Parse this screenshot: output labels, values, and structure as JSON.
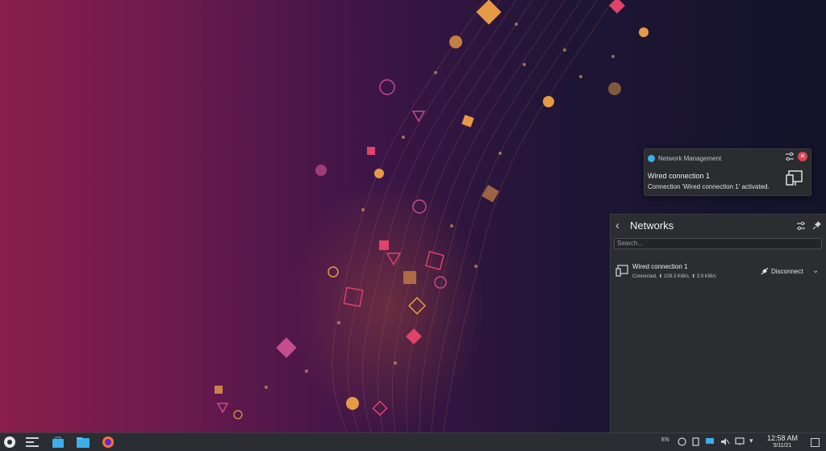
{
  "notification": {
    "app": "Network Management",
    "title": "Wired connection 1",
    "body": "Connection 'Wired connection 1' activated."
  },
  "networks": {
    "title": "Networks",
    "search_placeholder": "Search...",
    "connection": {
      "name": "Wired connection 1",
      "status": "Connected, ⬇ 109.3 KiB/s, ⬆ 3.9 KiB/s",
      "action": "Disconnect"
    }
  },
  "taskbar": {
    "keyboard_layout": "EN",
    "time": "12:58 AM",
    "date": "5/11/21"
  },
  "colors": {
    "accent": "#3daee9",
    "close": "#da4453",
    "panel_bg": "#2b2d30",
    "taskbar_bg": "#2a2e32"
  }
}
